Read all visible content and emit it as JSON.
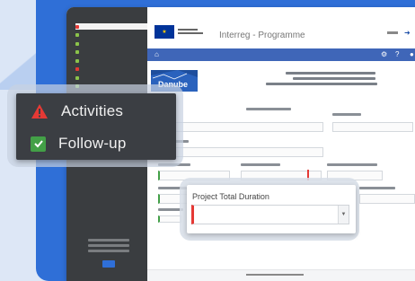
{
  "colors": {
    "frame_blue": "#2f6fd7",
    "sidebar_dark": "#3a3d40",
    "navbar_blue": "#3f66b8",
    "logo_blue": "#1e4e9d",
    "warning_red": "#e53935",
    "check_green": "#43a047"
  },
  "icons": {
    "eu_flag": "eu-flag-icon",
    "top_right": "chevron-icon",
    "nav_home": "home-icon",
    "nav_settings": "gear-icon",
    "nav_help": "help-icon",
    "nav_user": "user-icon",
    "warning": "warning-triangle-icon",
    "check": "checkbox-checked-icon",
    "dropdown": "caret-down-icon"
  },
  "sidebar": {
    "items": [
      {
        "label": "",
        "status": "warn",
        "active": true
      },
      {
        "label": "",
        "status": "ok"
      },
      {
        "label": "",
        "status": "ok"
      },
      {
        "label": "",
        "status": "ok"
      },
      {
        "label": "",
        "status": "ok"
      },
      {
        "label": "",
        "status": "warn"
      },
      {
        "label": "",
        "status": "ok",
        "dim": true
      },
      {
        "label": "",
        "status": "ok",
        "dim": true
      }
    ]
  },
  "header": {
    "app_title": "Interreg - Programme"
  },
  "banner": {
    "logo_label": "Danube"
  },
  "callout_left": {
    "row1": "Activities",
    "row2": "Follow-up"
  },
  "callout_right": {
    "label": "Project Total Duration",
    "selected": ""
  }
}
